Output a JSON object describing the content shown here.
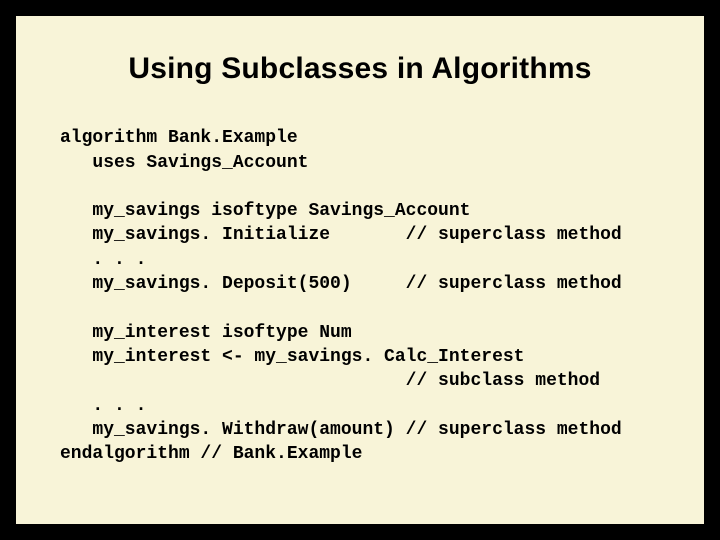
{
  "title": "Using Subclasses in Algorithms",
  "code": {
    "l01": "algorithm Bank.Example",
    "l02": "   uses Savings_Account",
    "l03": "",
    "l04": "   my_savings isoftype Savings_Account",
    "l05": "   my_savings. Initialize       // superclass method",
    "l06": "   . . .",
    "l07": "   my_savings. Deposit(500)     // superclass method",
    "l08": "",
    "l09": "   my_interest isoftype Num",
    "l10": "   my_interest <- my_savings. Calc_Interest",
    "l11": "                                // subclass method",
    "l12": "   . . .",
    "l13": "   my_savings. Withdraw(amount) // superclass method",
    "l14": "endalgorithm // Bank.Example"
  }
}
